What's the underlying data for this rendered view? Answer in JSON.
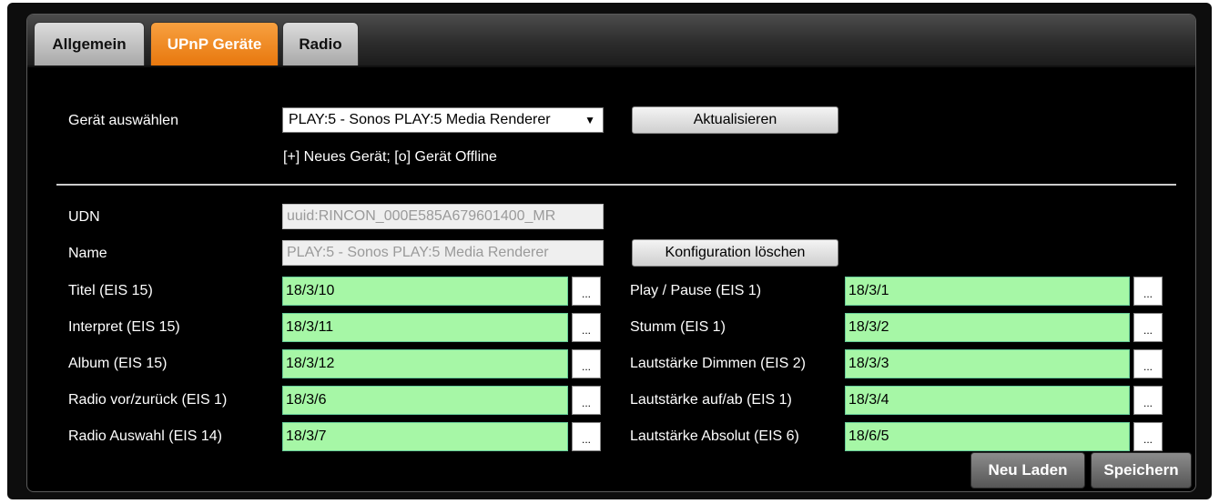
{
  "tabs": [
    {
      "label": "Allgemein"
    },
    {
      "label": "UPnP Geräte"
    },
    {
      "label": "Radio"
    }
  ],
  "device": {
    "label": "Gerät auswählen",
    "selected": "PLAY:5 - Sonos PLAY:5 Media Renderer",
    "refresh_label": "Aktualisieren",
    "hint": "[+] Neues Gerät; [o] Gerät Offline"
  },
  "info": {
    "udn_label": "UDN",
    "udn_value": "uuid:RINCON_000E585A679601400_MR",
    "name_label": "Name",
    "name_value": "PLAY:5 - Sonos PLAY:5 Media Renderer",
    "delete_label": "Konfiguration löschen"
  },
  "left_rows": [
    {
      "label": "Titel (EIS 15)",
      "value": "18/3/10"
    },
    {
      "label": "Interpret (EIS 15)",
      "value": "18/3/11"
    },
    {
      "label": "Album (EIS 15)",
      "value": "18/3/12"
    },
    {
      "label": "Radio vor/zurück (EIS 1)",
      "value": "18/3/6"
    },
    {
      "label": "Radio Auswahl (EIS 14)",
      "value": "18/3/7"
    }
  ],
  "right_rows": [
    {
      "label": "Play / Pause (EIS 1)",
      "value": "18/3/1"
    },
    {
      "label": "Stumm (EIS 1)",
      "value": "18/3/2"
    },
    {
      "label": "Lautstärke Dimmen (EIS 2)",
      "value": "18/3/3"
    },
    {
      "label": "Lautstärke auf/ab (EIS 1)",
      "value": "18/3/4"
    },
    {
      "label": "Lautstärke Absolut (EIS 6)",
      "value": "18/6/5"
    }
  ],
  "browse_label": "...",
  "actions": {
    "reload_label": "Neu Laden",
    "save_label": "Speichern"
  },
  "colors": {
    "active_tab": "#f08a20",
    "group_address_bg": "#a6f7a6"
  }
}
